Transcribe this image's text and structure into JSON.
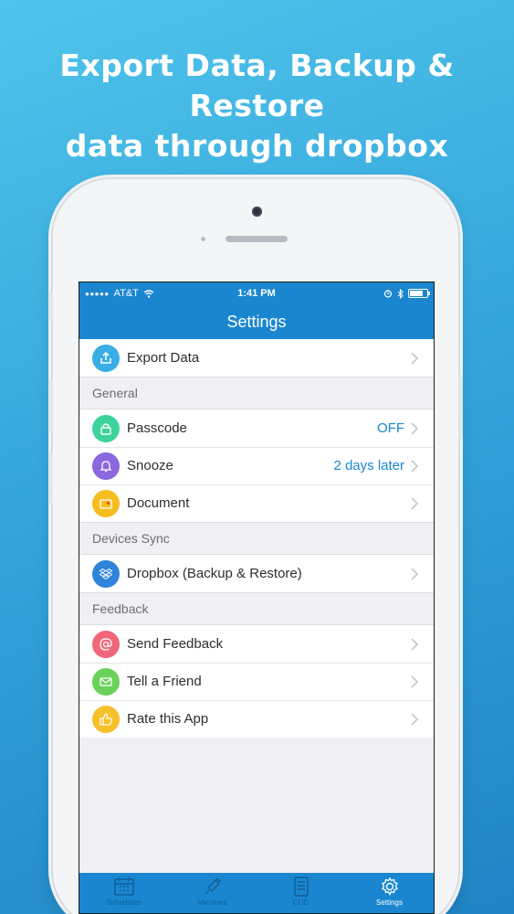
{
  "headline": {
    "line1": "Export Data, Backup & Restore",
    "line2": "data through dropbox"
  },
  "status_bar": {
    "carrier": "AT&T",
    "time": "1:41 PM"
  },
  "nav": {
    "title": "Settings"
  },
  "rows": {
    "export": {
      "label": "Export Data"
    },
    "passcode": {
      "label": "Passcode",
      "value": "OFF"
    },
    "snooze": {
      "label": "Snooze",
      "value": "2 days later"
    },
    "document": {
      "label": "Document"
    },
    "dropbox": {
      "label": "Dropbox (Backup & Restore)"
    },
    "send_feedback": {
      "label": "Send Feedback"
    },
    "tell_friend": {
      "label": "Tell a Friend"
    },
    "rate_app": {
      "label": "Rate this App"
    }
  },
  "sections": {
    "general": "General",
    "devices_sync": "Devices Sync",
    "feedback": "Feedback"
  },
  "tabs": [
    {
      "label": "Schedules",
      "icon": "calendar-icon"
    },
    {
      "label": "Vaccines",
      "icon": "syringe-icon"
    },
    {
      "label": "CDC",
      "icon": "document-icon"
    },
    {
      "label": "Settings",
      "icon": "gear-icon"
    }
  ],
  "colors": {
    "accent": "#1a86cf",
    "export_icon": "#38aee4",
    "passcode_icon": "#3ed39b",
    "snooze_icon": "#8b67e0",
    "document_icon": "#f5bd1f",
    "dropbox_icon": "#2e84d9",
    "send_feedback_icon": "#f0677a",
    "tell_friend_icon": "#6ad25a",
    "rate_app_icon": "#f6c12a"
  }
}
